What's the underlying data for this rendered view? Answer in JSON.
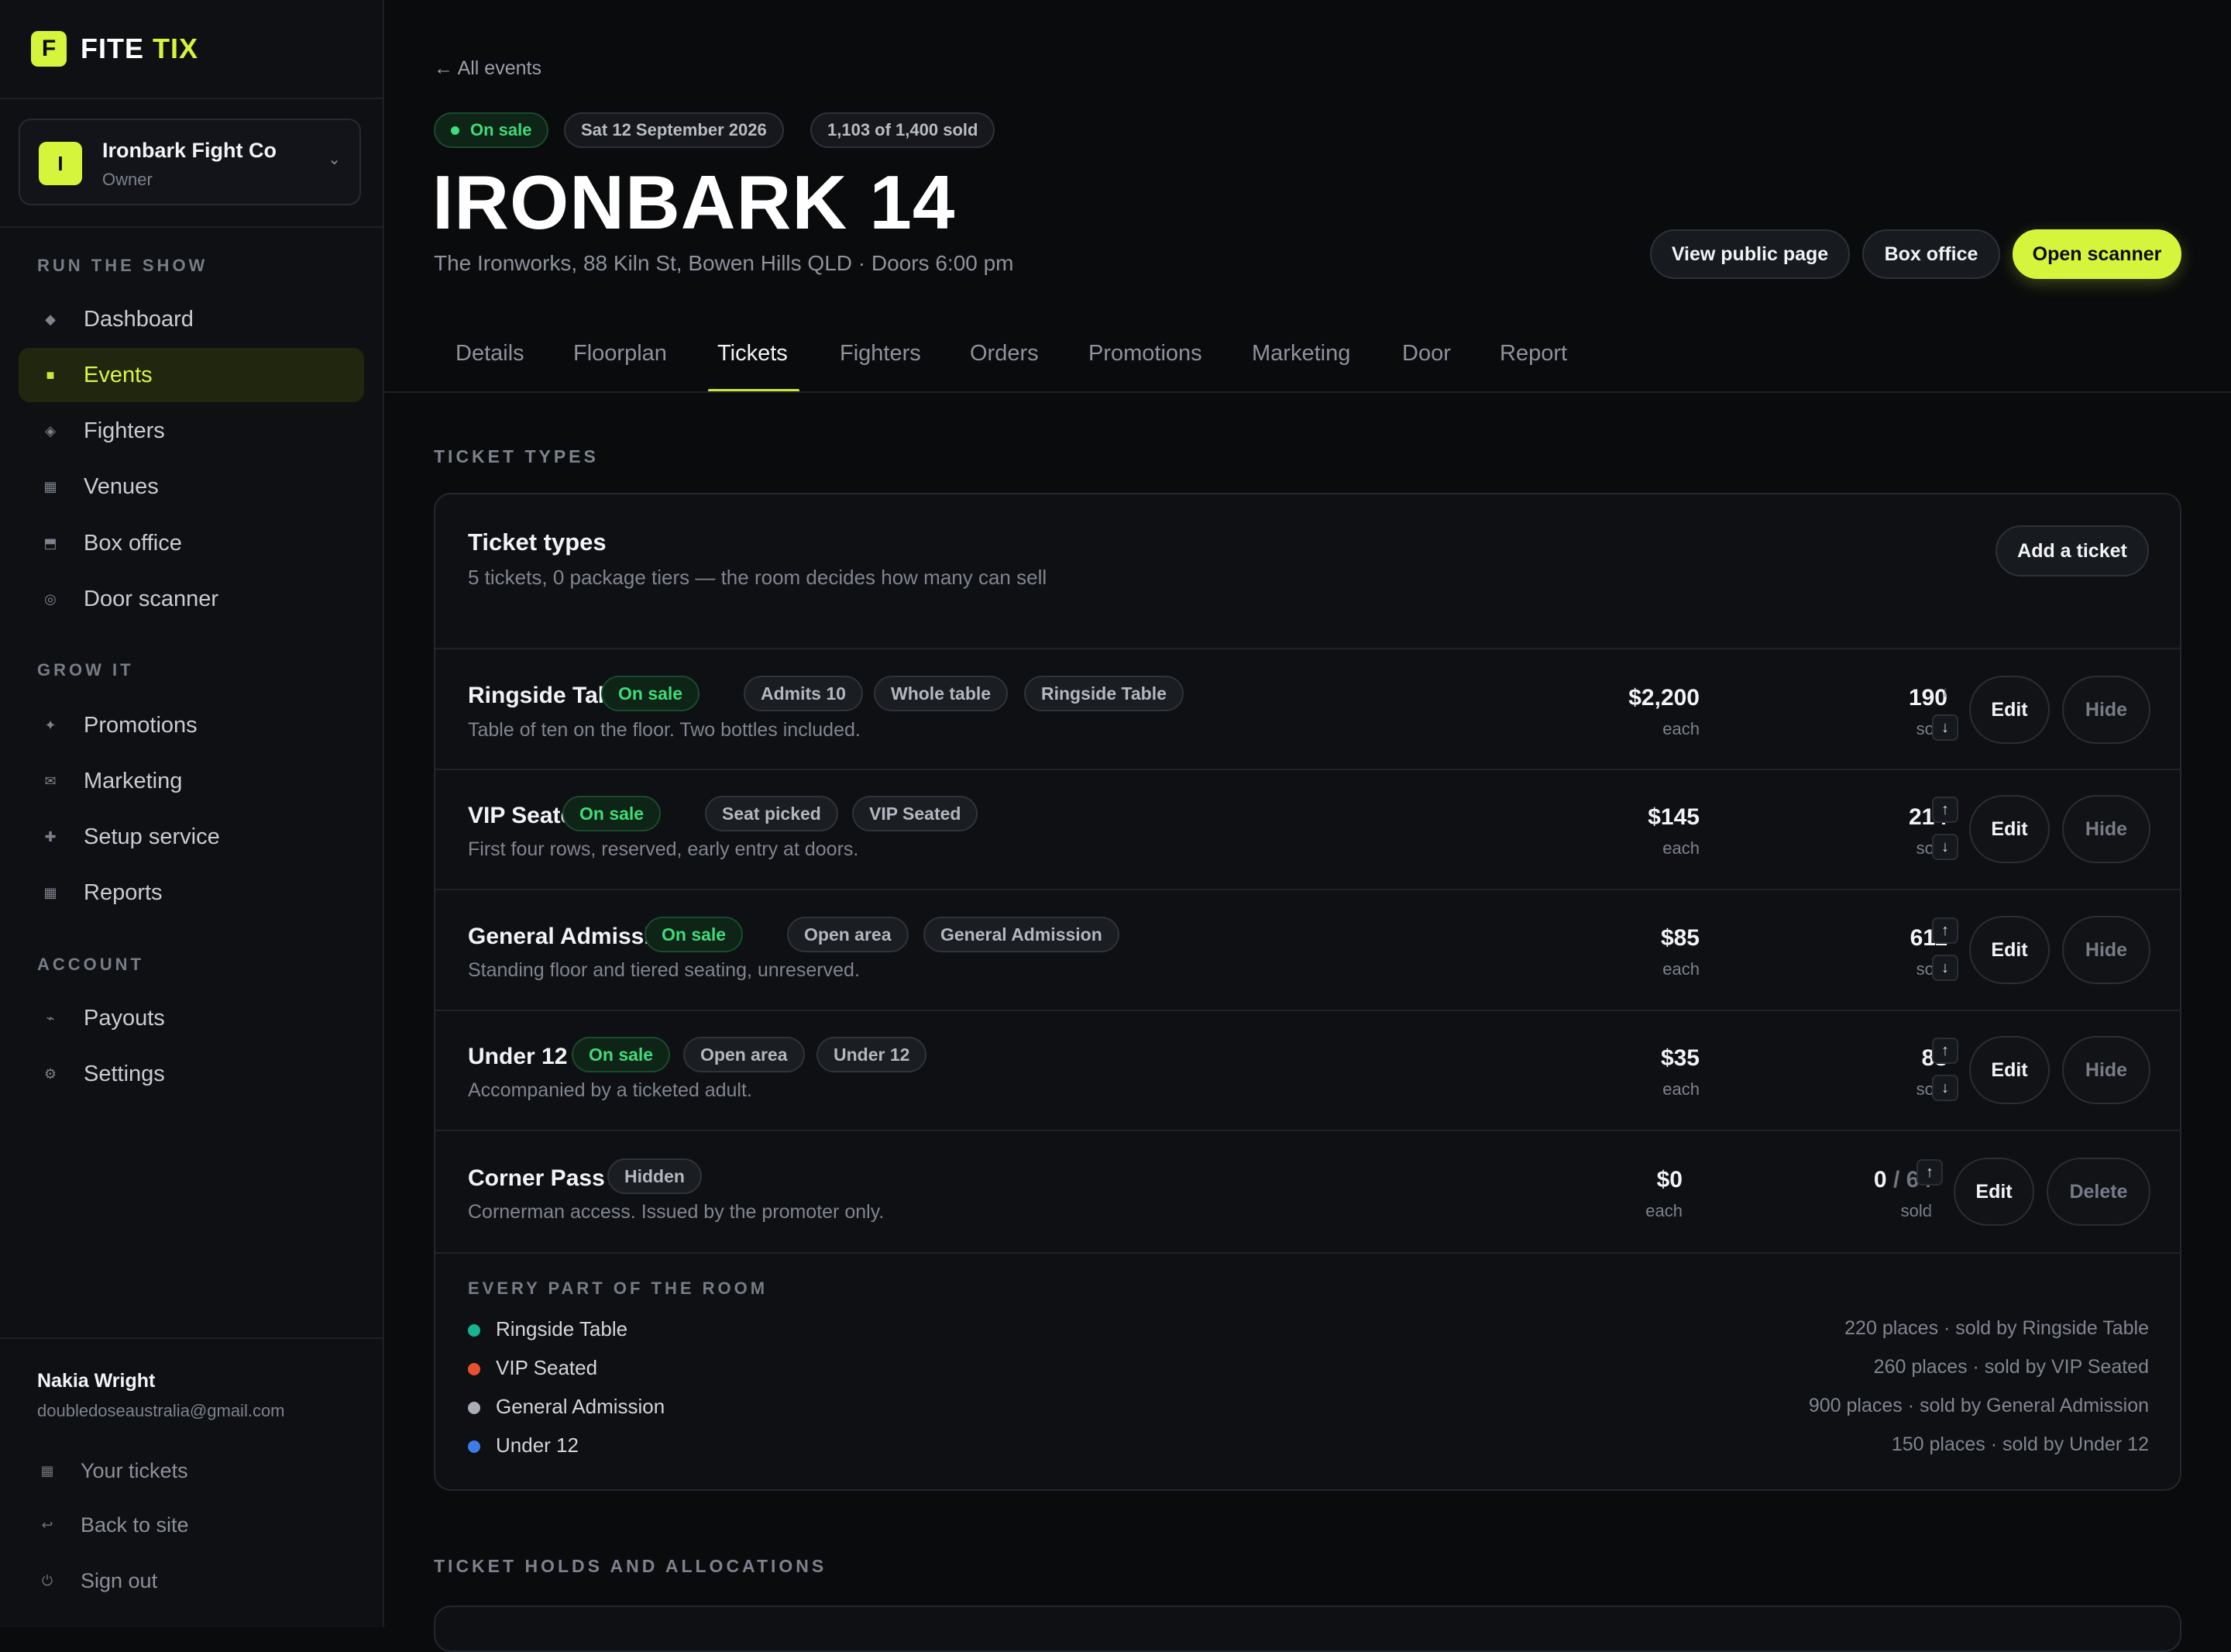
{
  "brand": {
    "mark": "F",
    "name_part1": "FITE",
    "name_part2": "TIX",
    "accent": "#d4f53c"
  },
  "org": {
    "avatar": "I",
    "name": "Ironbark Fight Co",
    "role": "Owner"
  },
  "sidebar": {
    "sections": [
      {
        "label": "RUN THE SHOW"
      },
      {
        "label": "GROW IT"
      },
      {
        "label": "ACCOUNT"
      }
    ],
    "items": [
      {
        "label": "Dashboard",
        "icon": "diamond-icon"
      },
      {
        "label": "Events",
        "icon": "square-icon",
        "active": true
      },
      {
        "label": "Fighters",
        "icon": "diamond-outline-icon"
      },
      {
        "label": "Venues",
        "icon": "grid-icon"
      },
      {
        "label": "Box office",
        "icon": "box-icon"
      },
      {
        "label": "Door scanner",
        "icon": "circle-icon"
      },
      {
        "label": "Promotions",
        "icon": "sparkle-icon"
      },
      {
        "label": "Marketing",
        "icon": "mail-icon"
      },
      {
        "label": "Setup service",
        "icon": "plus-icon"
      },
      {
        "label": "Reports",
        "icon": "grid-icon"
      },
      {
        "label": "Payouts",
        "icon": "wave-icon"
      },
      {
        "label": "Settings",
        "icon": "gear-icon"
      }
    ],
    "user": {
      "name": "Nakia Wright",
      "email": "doubledoseaustralia@gmail.com"
    },
    "footer": [
      {
        "label": "Your tickets",
        "icon": "ticket-icon"
      },
      {
        "label": "Back to site",
        "icon": "return-icon"
      },
      {
        "label": "Sign out",
        "icon": "power-icon"
      }
    ]
  },
  "header": {
    "back": "← All events",
    "status": "On sale",
    "date": "Sat 12 September 2026",
    "sold": "1,103 of 1,400 sold",
    "title": "IRONBARK 14",
    "subtitle": "The Ironworks, 88 Kiln St, Bowen Hills QLD · Doors 6:00 pm",
    "buttons": {
      "public": "View public page",
      "box_office": "Box office",
      "scanner": "Open scanner"
    }
  },
  "tabs": [
    "Details",
    "Floorplan",
    "Tickets",
    "Fighters",
    "Orders",
    "Promotions",
    "Marketing",
    "Door",
    "Report"
  ],
  "active_tab": "Tickets",
  "ticket_types": {
    "section_label": "TICKET TYPES",
    "title": "Ticket types",
    "subtitle": "5 tickets, 0 package tiers — the room decides how many can sell",
    "add_button": "Add a ticket",
    "each": "each",
    "sold_word": "sold",
    "rows": [
      {
        "name": "Ringside Table",
        "tags": [
          "On sale",
          "Admits 10",
          "Whole table",
          "Ringside Table"
        ],
        "desc": "Table of ten on the floor. Two bottles included.",
        "price": "$2,200",
        "sold": "190",
        "edit": "Edit",
        "action": "Hide"
      },
      {
        "name": "VIP Seated",
        "tags": [
          "On sale",
          "Seat picked",
          "VIP Seated"
        ],
        "desc": "First four rows, reserved, early entry at doors.",
        "price": "$145",
        "sold": "214",
        "edit": "Edit",
        "action": "Hide"
      },
      {
        "name": "General Admission",
        "tags": [
          "On sale",
          "Open area",
          "General Admission"
        ],
        "desc": "Standing floor and tiered seating, unreserved.",
        "price": "$85",
        "sold": "611",
        "edit": "Edit",
        "action": "Hide"
      },
      {
        "name": "Under 12",
        "tags": [
          "On sale",
          "Open area",
          "Under 12"
        ],
        "desc": "Accompanied by a ticketed adult.",
        "price": "$35",
        "sold": "88",
        "edit": "Edit",
        "action": "Hide"
      },
      {
        "name": "Corner Pass",
        "tags": [
          "Hidden"
        ],
        "desc": "Cornerman access. Issued by the promoter only.",
        "price": "$0",
        "sold": "0",
        "cap": "/ 64",
        "edit": "Edit",
        "action": "Delete"
      }
    ],
    "room": {
      "label": "EVERY PART OF THE ROOM",
      "parts": [
        {
          "name": "Ringside Table",
          "meta": "220 places · sold by Ringside Table",
          "color": "#17b58f"
        },
        {
          "name": "VIP Seated",
          "meta": "260 places · sold by VIP Seated",
          "color": "#e8502f"
        },
        {
          "name": "General Admission",
          "meta": "900 places · sold by General Admission",
          "color": "#a9adb5"
        },
        {
          "name": "Under 12",
          "meta": "150 places · sold by Under 12",
          "color": "#3d7be6"
        }
      ]
    }
  },
  "holds": {
    "section_label": "TICKET HOLDS AND ALLOCATIONS"
  }
}
